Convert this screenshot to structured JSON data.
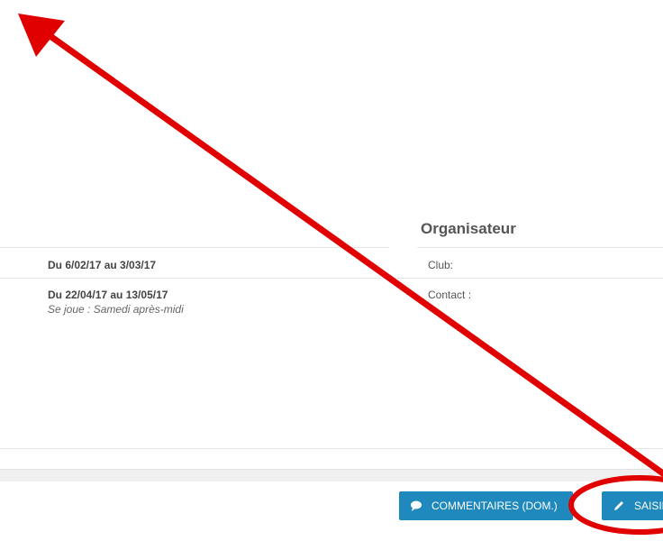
{
  "organisateur": {
    "title": "Organisateur",
    "club_label": "Club:",
    "contact_label": "Contact :"
  },
  "periods": [
    {
      "dates": "Du 6/02/17 au 3/03/17"
    },
    {
      "dates": "Du 22/04/17 au 13/05/17",
      "note": "Se joue : Samedi après-midi"
    }
  ],
  "buttons": {
    "comments": {
      "label": "COMMENTAIRES (DOM.)",
      "icon": "comment-icon"
    },
    "saisie": {
      "label": "SAISIE",
      "icon": "pencil-icon"
    }
  },
  "annotation": {
    "color": "#e00000",
    "shapes": [
      "arrow",
      "ellipse"
    ]
  }
}
